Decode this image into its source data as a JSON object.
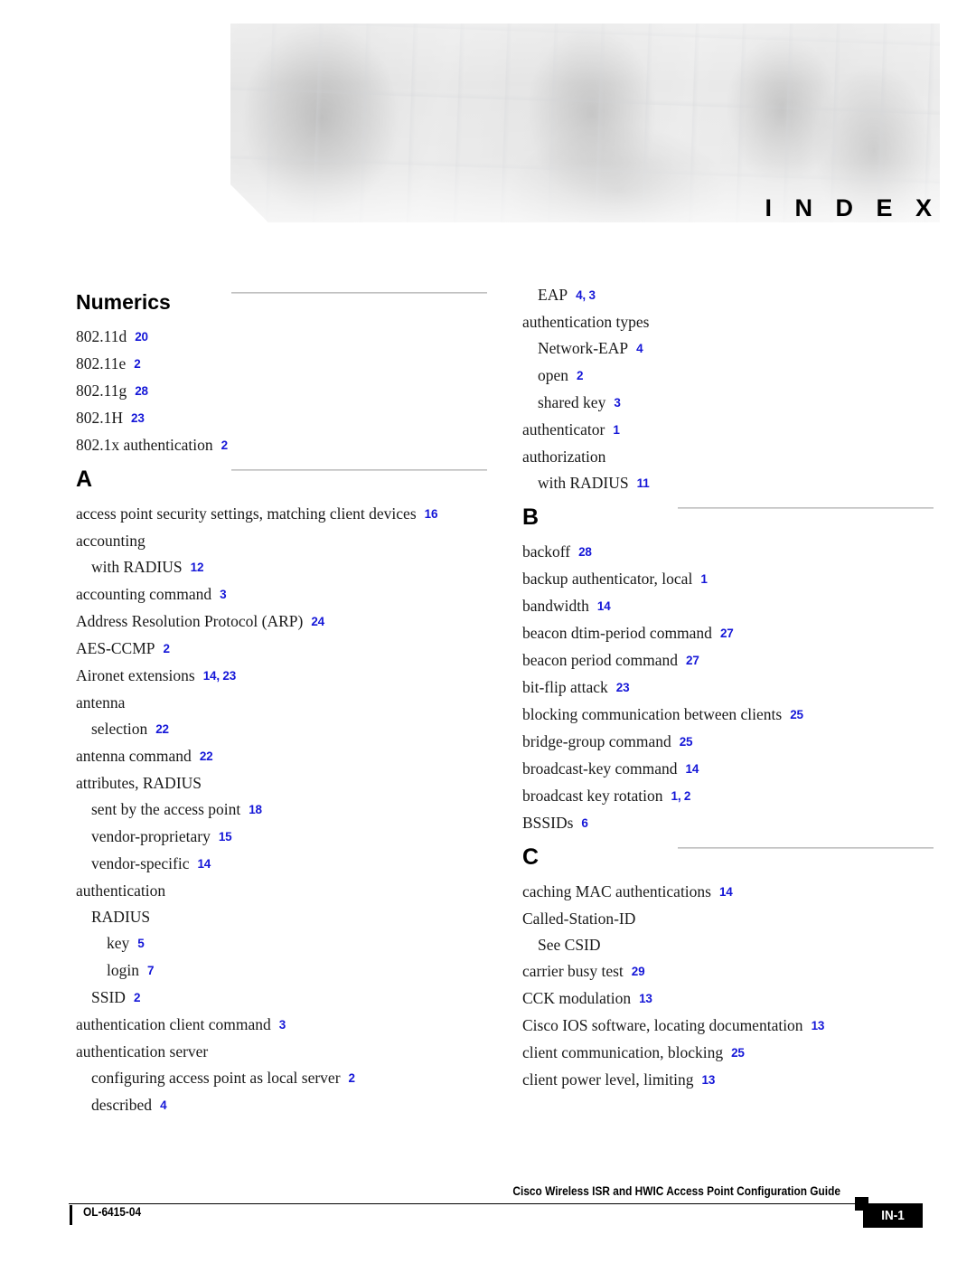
{
  "header": {
    "index_word": "I N D E X",
    "banner_alt": "grayscale photo banner of people working with networking equipment and laptops"
  },
  "columns": [
    {
      "id": "left",
      "sections": [
        {
          "letter": "Numerics",
          "has_rule": true,
          "entries": [
            {
              "level": 0,
              "term": "802.11d",
              "pages": "20"
            },
            {
              "level": 0,
              "term": "802.11e",
              "pages": "2"
            },
            {
              "level": 0,
              "term": "802.11g",
              "pages": "28"
            },
            {
              "level": 0,
              "term": "802.1H",
              "pages": "23"
            },
            {
              "level": 0,
              "term": "802.1x authentication",
              "pages": "2"
            }
          ]
        },
        {
          "letter": "A",
          "has_rule": true,
          "entries": [
            {
              "level": 0,
              "term": "access point security settings, matching client devices",
              "pages": "16"
            },
            {
              "level": 0,
              "term": "accounting",
              "pages": ""
            },
            {
              "level": 1,
              "term": "with RADIUS",
              "pages": "12"
            },
            {
              "level": 0,
              "term": "accounting command",
              "pages": "3"
            },
            {
              "level": 0,
              "term": "Address Resolution Protocol (ARP)",
              "pages": "24"
            },
            {
              "level": 0,
              "term": "AES-CCMP",
              "pages": "2"
            },
            {
              "level": 0,
              "term": "Aironet extensions",
              "pages": "14, 23"
            },
            {
              "level": 0,
              "term": "antenna",
              "pages": ""
            },
            {
              "level": 1,
              "term": "selection",
              "pages": "22"
            },
            {
              "level": 0,
              "term": "antenna command",
              "pages": "22"
            },
            {
              "level": 0,
              "term": "attributes, RADIUS",
              "pages": ""
            },
            {
              "level": 1,
              "term": "sent by the access point",
              "pages": "18"
            },
            {
              "level": 1,
              "term": "vendor-proprietary",
              "pages": "15"
            },
            {
              "level": 1,
              "term": "vendor-specific",
              "pages": "14"
            },
            {
              "level": 0,
              "term": "authentication",
              "pages": ""
            },
            {
              "level": 1,
              "term": "RADIUS",
              "pages": ""
            },
            {
              "level": 2,
              "term": "key",
              "pages": "5"
            },
            {
              "level": 2,
              "term": "login",
              "pages": "7"
            },
            {
              "level": 1,
              "term": "SSID",
              "pages": "2"
            },
            {
              "level": 0,
              "term": "authentication client command",
              "pages": "3"
            },
            {
              "level": 0,
              "term": "authentication server",
              "pages": ""
            },
            {
              "level": 1,
              "term": "configuring access point as local server",
              "pages": "2"
            },
            {
              "level": 1,
              "term": "described",
              "pages": "4"
            }
          ]
        }
      ]
    },
    {
      "id": "right",
      "sections": [
        {
          "letter": "",
          "has_rule": false,
          "entries": [
            {
              "level": 1,
              "term": "EAP",
              "pages": "4, 3"
            },
            {
              "level": 0,
              "term": "authentication types",
              "pages": ""
            },
            {
              "level": 1,
              "term": "Network-EAP",
              "pages": "4"
            },
            {
              "level": 1,
              "term": "open",
              "pages": "2"
            },
            {
              "level": 1,
              "term": "shared key",
              "pages": "3"
            },
            {
              "level": 0,
              "term": "authenticator",
              "pages": "1"
            },
            {
              "level": 0,
              "term": "authorization",
              "pages": ""
            },
            {
              "level": 1,
              "term": "with RADIUS",
              "pages": "11"
            }
          ]
        },
        {
          "letter": "B",
          "has_rule": true,
          "entries": [
            {
              "level": 0,
              "term": "backoff",
              "pages": "28"
            },
            {
              "level": 0,
              "term": "backup authenticator, local",
              "pages": "1"
            },
            {
              "level": 0,
              "term": "bandwidth",
              "pages": "14"
            },
            {
              "level": 0,
              "term": "beacon dtim-period command",
              "pages": "27"
            },
            {
              "level": 0,
              "term": "beacon period command",
              "pages": "27"
            },
            {
              "level": 0,
              "term": "bit-flip attack",
              "pages": "23"
            },
            {
              "level": 0,
              "term": "blocking communication between clients",
              "pages": "25"
            },
            {
              "level": 0,
              "term": "bridge-group command",
              "pages": "25"
            },
            {
              "level": 0,
              "term": "broadcast-key command",
              "pages": "14"
            },
            {
              "level": 0,
              "term": "broadcast key rotation",
              "pages": "1, 2"
            },
            {
              "level": 0,
              "term": "BSSIDs",
              "pages": "6"
            }
          ]
        },
        {
          "letter": "C",
          "has_rule": true,
          "entries": [
            {
              "level": 0,
              "term": "caching MAC authentications",
              "pages": "14"
            },
            {
              "level": 0,
              "term": "Called-Station-ID",
              "pages": ""
            },
            {
              "level": 1,
              "term": "See CSID",
              "pages": ""
            },
            {
              "level": 0,
              "term": "carrier busy test",
              "pages": "29"
            },
            {
              "level": 0,
              "term": "CCK modulation",
              "pages": "13"
            },
            {
              "level": 0,
              "term": "Cisco IOS software, locating documentation",
              "pages": "13"
            },
            {
              "level": 0,
              "term": "client communication, blocking",
              "pages": "25"
            },
            {
              "level": 0,
              "term": "client power level, limiting",
              "pages": "13"
            }
          ]
        }
      ]
    }
  ],
  "footer": {
    "guide_title": "Cisco Wireless ISR and HWIC Access Point Configuration Guide",
    "doc_id": "OL-6415-04",
    "page_number": "IN-1"
  },
  "colors": {
    "page_number_blue": "#1517d8",
    "rule_gray": "#c9c9c9",
    "text_black": "#1a1a1a"
  }
}
